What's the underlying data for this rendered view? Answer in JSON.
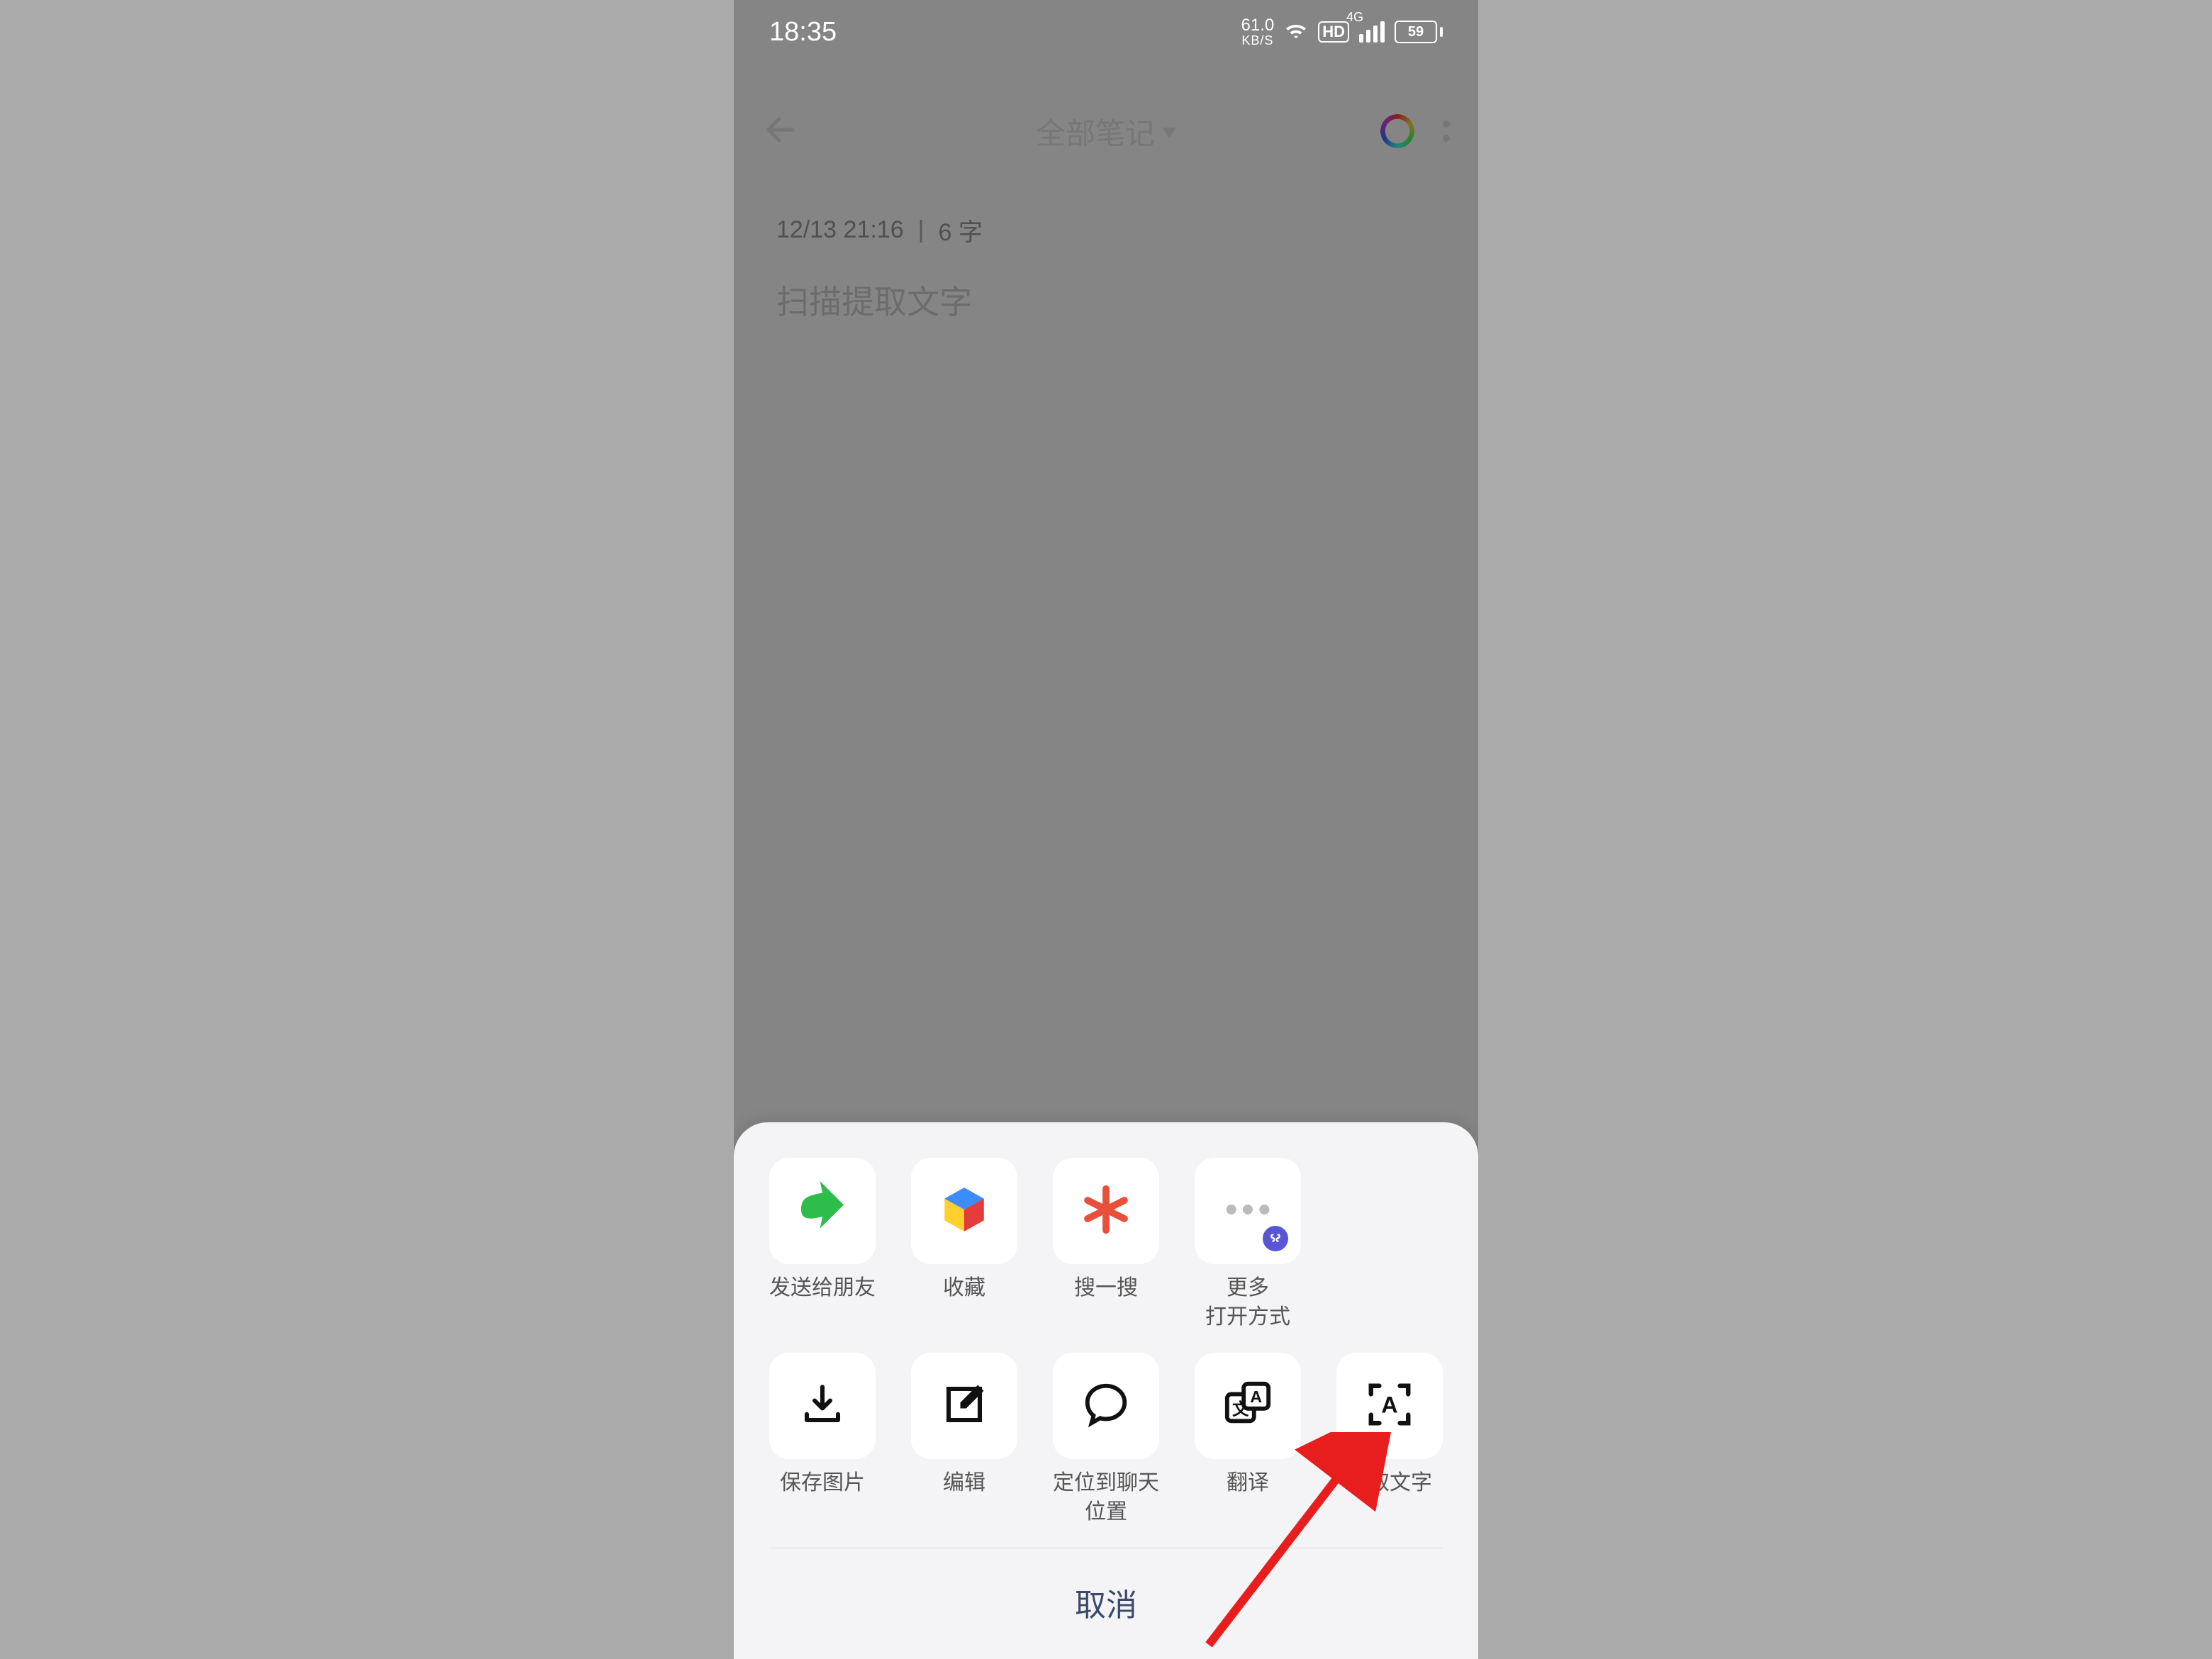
{
  "status": {
    "time": "18:35",
    "net_speed_top": "61.0",
    "net_speed_bot": "KB/S",
    "hd": "HD",
    "net_gen": "4G",
    "battery": "59"
  },
  "header": {
    "title": "全部笔记",
    "back_name": "back-icon",
    "palette_name": "palette-icon",
    "more_name": "more-icon"
  },
  "note": {
    "meta_date": "12/13 21:16",
    "meta_len": "6 字",
    "body": "扫描提取文字"
  },
  "sheet": {
    "row1": [
      {
        "label": "发送给朋友",
        "icon": "share-arrow-icon"
      },
      {
        "label": "收藏",
        "icon": "favorite-cube-icon"
      },
      {
        "label": "搜一搜",
        "icon": "search-spark-icon"
      },
      {
        "label": "更多\n打开方式",
        "icon": "more-open-icon"
      }
    ],
    "row2": [
      {
        "label": "保存图片",
        "icon": "download-icon"
      },
      {
        "label": "编辑",
        "icon": "edit-icon"
      },
      {
        "label": "定位到聊天\n位置",
        "icon": "chat-bubble-icon"
      },
      {
        "label": "翻译",
        "icon": "translate-icon"
      },
      {
        "label": "提取文字",
        "icon": "ocr-icon"
      }
    ],
    "cancel": "取消"
  }
}
